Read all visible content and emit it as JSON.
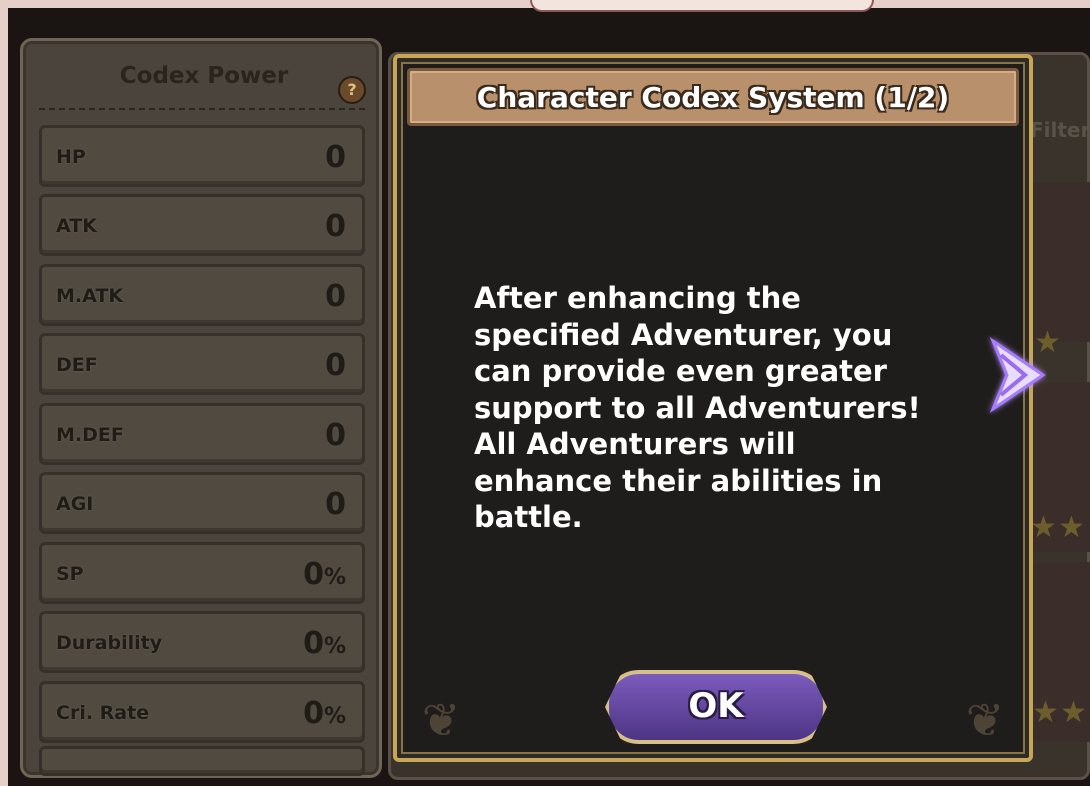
{
  "codex_panel": {
    "title": "Codex Power",
    "help_icon": "question-icon",
    "stats": [
      {
        "label": "HP",
        "value": "0",
        "unit": ""
      },
      {
        "label": "ATK",
        "value": "0",
        "unit": ""
      },
      {
        "label": "M.ATK",
        "value": "0",
        "unit": ""
      },
      {
        "label": "DEF",
        "value": "0",
        "unit": ""
      },
      {
        "label": "M.DEF",
        "value": "0",
        "unit": ""
      },
      {
        "label": "AGI",
        "value": "0",
        "unit": ""
      },
      {
        "label": "SP",
        "value": "0",
        "unit": "%"
      },
      {
        "label": "Durability",
        "value": "0",
        "unit": "%"
      },
      {
        "label": "Cri. Rate",
        "value": "0",
        "unit": "%"
      }
    ]
  },
  "background": {
    "filter_label": "Filter"
  },
  "dialog": {
    "title": "Character Codex System (1/2)",
    "body_lines": [
      "After enhancing the",
      "specified Adventurer, you",
      "can provide even greater",
      "support to all Adventurers!",
      "All Adventurers will",
      "enhance their abilities in",
      "battle."
    ],
    "ok_label": "OK",
    "next_icon": "next-arrow-icon"
  },
  "colors": {
    "dialog_border": "#c8a657",
    "header_bg": "#b8906b",
    "ok_button": "#6a4aa8",
    "arrow_glow": "#b48cff"
  }
}
